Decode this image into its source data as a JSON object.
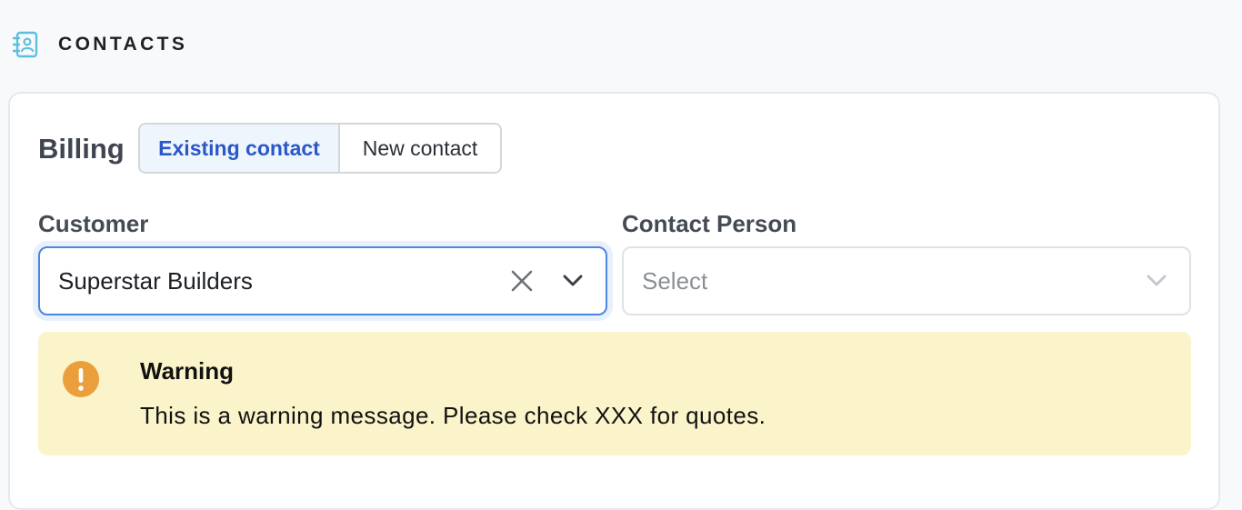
{
  "section": {
    "title": "CONTACTS",
    "icon": "address-book-icon",
    "icon_color": "#5bc0de"
  },
  "billing": {
    "label": "Billing",
    "tabs": [
      {
        "label": "Existing contact",
        "active": true
      },
      {
        "label": "New contact",
        "active": false
      }
    ]
  },
  "customer": {
    "label": "Customer",
    "value": "Superstar Builders",
    "clear_icon": "close-icon",
    "dropdown_icon": "chevron-down-icon"
  },
  "contact_person": {
    "label": "Contact Person",
    "placeholder": "Select",
    "dropdown_icon": "chevron-down-icon"
  },
  "warning": {
    "title": "Warning",
    "message": "This is a warning message. Please check XXX for quotes.",
    "icon": "exclamation-circle-icon",
    "background": "#fbf3c9",
    "icon_color": "#ea9f3a"
  },
  "colors": {
    "accent": "#2b58c7",
    "focus_border": "#4a86e2"
  }
}
